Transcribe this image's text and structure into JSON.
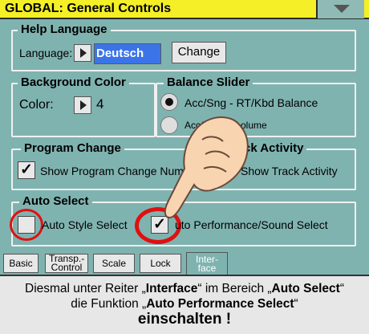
{
  "window": {
    "title": "GLOBAL:  General Controls"
  },
  "help_language": {
    "title": "Help  Language",
    "label": "Language:",
    "value": "Deutsch",
    "change_label": "Change"
  },
  "background_color": {
    "title": "Background Color",
    "label": "Color:",
    "value": "4"
  },
  "balance_slider": {
    "title": "Balance Slider",
    "option1": "Acc/Sng - RT/Kbd Balance",
    "option2": "Acc/Sng - Volume",
    "option2_visible_left": "Acc/S",
    "option2_visible_right": "olume"
  },
  "program_change": {
    "title": "Program Change",
    "checkbox_label": "Show Program Change Num"
  },
  "track_activity": {
    "title_visible": "ck Activity",
    "checkbox_label_visible": "Show Track Activity"
  },
  "auto_select": {
    "title": "Auto Select",
    "style_label": "Auto Style Select",
    "performance_label": "Auto Performance/Sound Select",
    "performance_visible": "uto Performance/Sound Select"
  },
  "tabs": [
    {
      "label": "Basic"
    },
    {
      "label": "Transp.-Control"
    },
    {
      "label": "Scale"
    },
    {
      "label": "Lock"
    },
    {
      "label": "Inter-face"
    }
  ],
  "instruction": {
    "line1a": "Diesmal unter Reiter „",
    "line1b": "Interface",
    "line1c": "“ im Bereich „",
    "line1d": "Auto Select",
    "line1e": "“",
    "line2a": "die Funktion „",
    "line2b": "Auto Performance Select",
    "line2c": "“",
    "line3": "einschalten !"
  },
  "colors": {
    "titlebar": "#f4ef26",
    "panel": "#7fb3b0",
    "selection": "#3b74e8",
    "highlight_circle": "#e01010"
  }
}
